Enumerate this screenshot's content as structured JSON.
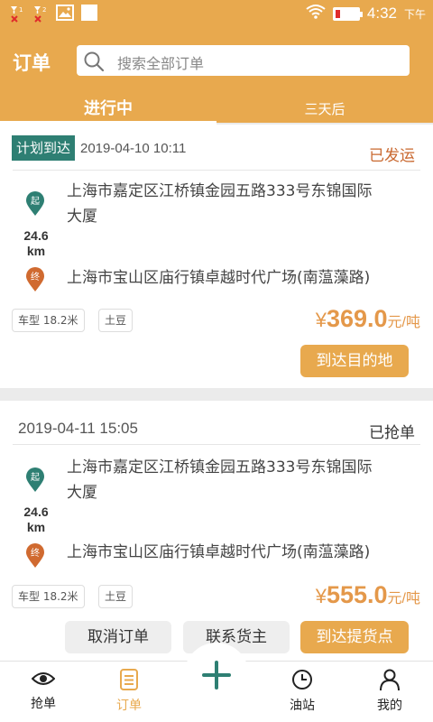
{
  "status_bar": {
    "time": "4:32",
    "ampm": "下午"
  },
  "header": {
    "title": "订单",
    "search_placeholder": "搜索全部订单",
    "tabs": [
      {
        "label": "进行中"
      },
      {
        "label": "三天后"
      }
    ]
  },
  "orders": [
    {
      "badge": "计划到达",
      "datetime": "2019-04-10 10:11",
      "status": "已发运",
      "start_marker": "起",
      "end_marker": "终",
      "from_line1": "上海市嘉定区江桥镇金园五路333号东锦国际",
      "from_line2": "大厦",
      "distance_value": "24.6",
      "distance_unit": "km",
      "to": "上海市宝山区庙行镇卓越时代广场(南蕰藻路)",
      "vehicle": "车型 18.2米",
      "cargo": "土豆",
      "currency": "¥",
      "price": "369.0",
      "price_unit": "元/吨",
      "buttons": [
        "到达目的地"
      ]
    },
    {
      "datetime": "2019-04-11 15:05",
      "status": "已抢单",
      "start_marker": "起",
      "end_marker": "终",
      "from_line1": "上海市嘉定区江桥镇金园五路333号东锦国际",
      "from_line2": "大厦",
      "distance_value": "24.6",
      "distance_unit": "km",
      "to": "上海市宝山区庙行镇卓越时代广场(南蕰藻路)",
      "vehicle": "车型 18.2米",
      "cargo": "土豆",
      "currency": "¥",
      "price": "555.0",
      "price_unit": "元/吨",
      "buttons": [
        "取消订单",
        "联系货主",
        "到达提货点"
      ]
    }
  ],
  "bottom_nav": [
    {
      "label": "抢单",
      "icon": "eye-icon"
    },
    {
      "label": "订单",
      "icon": "order-list-icon"
    },
    {
      "label": "",
      "icon": "plus-icon"
    },
    {
      "label": "油站",
      "icon": "clock-icon"
    },
    {
      "label": "我的",
      "icon": "person-icon"
    }
  ],
  "colors": {
    "brand": "#e8a94e",
    "badge": "#2e7f73",
    "status_shipped": "#c9682f",
    "price": "#e4984a",
    "start_pin": "#2e7f73",
    "end_pin": "#d06a30"
  }
}
